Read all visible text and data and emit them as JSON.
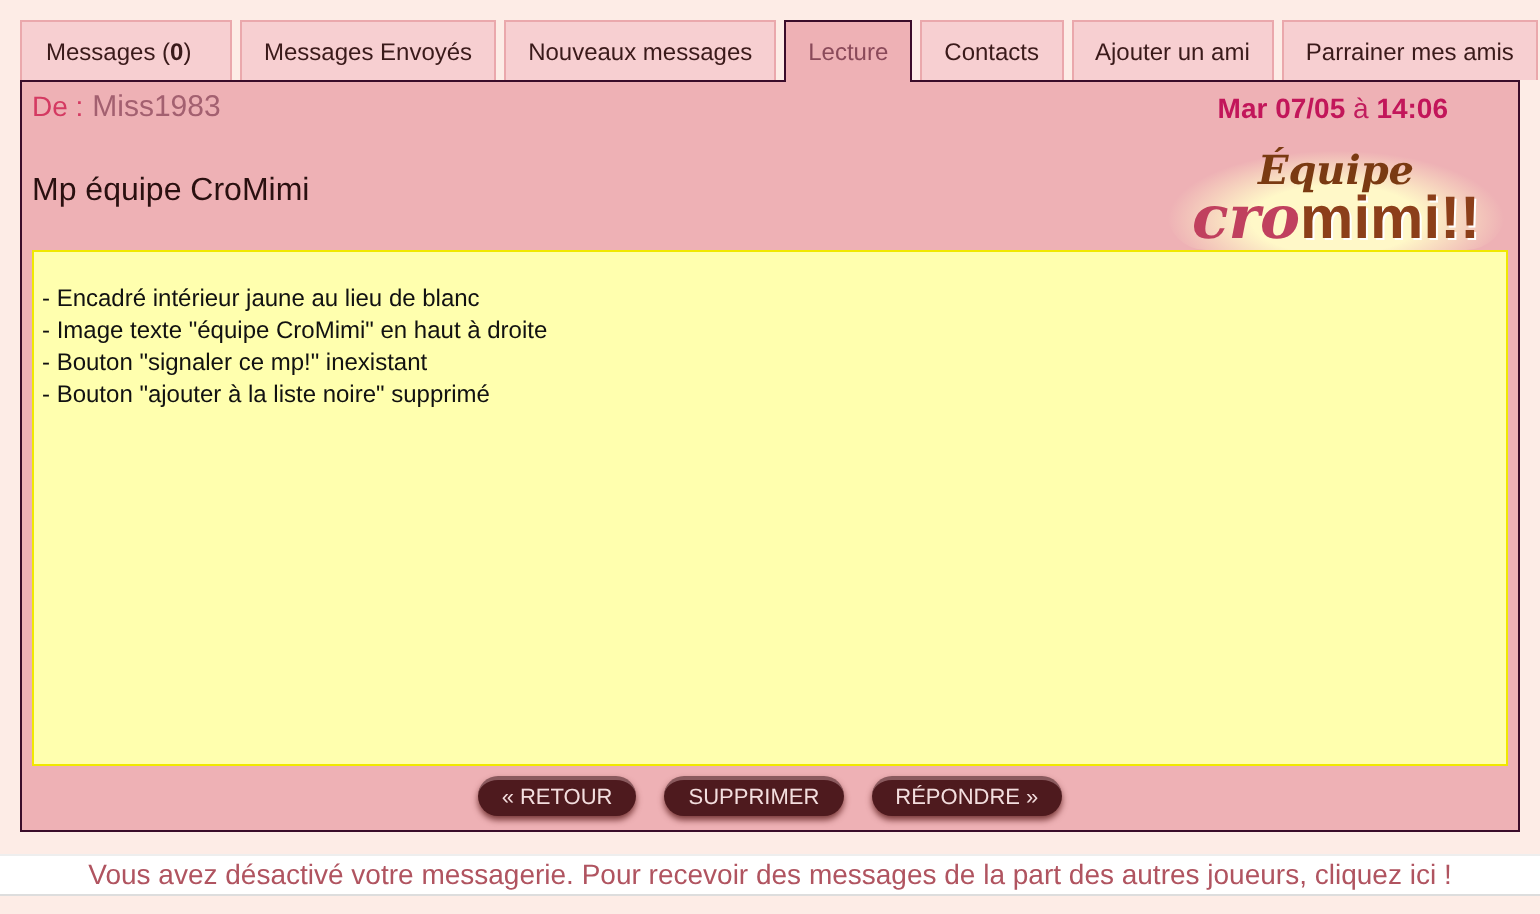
{
  "tabs": [
    {
      "label": "Messages (**0**)",
      "selected": false
    },
    {
      "label": "Messages Envoyés",
      "selected": false
    },
    {
      "label": "Nouveaux messages",
      "selected": false
    },
    {
      "label": "Lecture",
      "selected": true
    },
    {
      "label": "Contacts",
      "selected": false
    },
    {
      "label": "Ajouter un ami",
      "selected": false
    },
    {
      "label": "Parrainer mes amis",
      "selected": false
    }
  ],
  "message": {
    "from_label": "De :",
    "sender": "Miss1983",
    "date": "**Mar 07/05** à **14:06**",
    "subject": "Mp équipe CroMimi",
    "logo": {
      "top": "Équipe",
      "bottom_left": "cro",
      "bottom_right": "mimi!!"
    },
    "body": [
      "- Encadré intérieur jaune au lieu de blanc",
      "- Image texte \"équipe CroMimi\" en haut à droite",
      "- Bouton \"signaler ce mp!\" inexistant",
      "- Bouton \"ajouter à la liste noire\" supprimé"
    ]
  },
  "buttons": [
    "« RETOUR",
    "SUPPRIMER",
    "RÉPONDRE »"
  ],
  "notice": "Vous avez désactivé votre messagerie. Pour recevoir des messages de la part des autres joueurs, cliquez ici !"
}
